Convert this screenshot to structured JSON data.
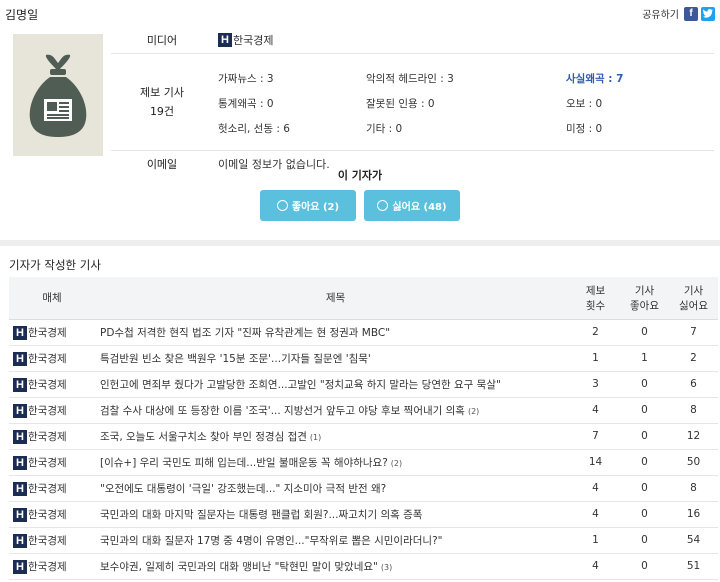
{
  "reporter": {
    "name": "김명일"
  },
  "share": {
    "label": "공유하기",
    "facebook_icon": "f",
    "twitter_icon": "t"
  },
  "profile": {
    "media_label": "미디어",
    "media_name": "한국경제",
    "media_badge": "H",
    "report_label": "제보 기사",
    "report_count": "19건",
    "counts": [
      {
        "label": "가짜뉴스 : 3",
        "highlight": false
      },
      {
        "label": "악의적 헤드라인 : 3",
        "highlight": false
      },
      {
        "label": "사실왜곡 : 7",
        "highlight": true
      },
      {
        "label": "통계왜곡 : 0",
        "highlight": false
      },
      {
        "label": "잘못된 인용 : 0",
        "highlight": false
      },
      {
        "label": "오보 : 0",
        "highlight": false
      },
      {
        "label": "헛소리, 선동 : 6",
        "highlight": false
      },
      {
        "label": "기타 : 0",
        "highlight": false
      },
      {
        "label": "미정 : 0",
        "highlight": false
      }
    ],
    "email_label": "이메일",
    "email_value": "이메일 정보가 없습니다."
  },
  "like_box": {
    "title": "이 기자가",
    "like_label": "좋아요 (2)",
    "dislike_label": "싫어요 (48)",
    "accent": "#5bc0de"
  },
  "articles_section": {
    "title": "기자가 작성한 기사",
    "headers": {
      "media": "매체",
      "title": "제목",
      "reports_1": "제보",
      "reports_2": "횟수",
      "likes_1": "기사",
      "likes_2": "좋아요",
      "dislikes_1": "기사",
      "dislikes_2": "싫어요"
    },
    "rows": [
      {
        "media": "한국경제",
        "title": "PD수첩 저격한 현직 법조 기자 \"진짜 유착관계는 현 정권과 MBC\"",
        "count": "",
        "reports": "2",
        "likes": "0",
        "dislikes": "7"
      },
      {
        "media": "한국경제",
        "title": "특검반원 빈소 찾은 백원우 '15분 조문'...기자들 질문엔 '침묵'",
        "count": "",
        "reports": "1",
        "likes": "1",
        "dislikes": "2"
      },
      {
        "media": "한국경제",
        "title": "인헌고에 면죄부 줬다가 고발당한 조희연...고발인 \"정치교육 하지 말라는 당연한 요구 묵살\"",
        "count": "",
        "reports": "3",
        "likes": "0",
        "dislikes": "6"
      },
      {
        "media": "한국경제",
        "title": "검찰 수사 대상에 또 등장한 이름 '조국'... 지방선거 앞두고 야당 후보 찍어내기 의혹",
        "count": "(2)",
        "reports": "4",
        "likes": "0",
        "dislikes": "8"
      },
      {
        "media": "한국경제",
        "title": "조국, 오늘도 서울구치소 찾아 부인 정경심 접견",
        "count": "(1)",
        "reports": "7",
        "likes": "0",
        "dislikes": "12"
      },
      {
        "media": "한국경제",
        "title": "[이슈+] 우리 국민도 피해 입는데...반일 불매운동 꼭 해야하나요?",
        "count": "(2)",
        "reports": "14",
        "likes": "0",
        "dislikes": "50"
      },
      {
        "media": "한국경제",
        "title": "\"오전에도 대통령이 '극일' 강조했는데...\" 지소미아 극적 반전 왜?",
        "count": "",
        "reports": "4",
        "likes": "0",
        "dislikes": "8"
      },
      {
        "media": "한국경제",
        "title": "국민과의 대화 마지막 질문자는 대통령 팬클럽 회원?...짜고치기 의혹 증폭",
        "count": "",
        "reports": "4",
        "likes": "0",
        "dislikes": "16"
      },
      {
        "media": "한국경제",
        "title": "국민과의 대화 질문자 17명 중 4명이 유명인...\"무작위로 뽑은 시민이라더니?\"",
        "count": "",
        "reports": "1",
        "likes": "0",
        "dislikes": "54"
      },
      {
        "media": "한국경제",
        "title": "보수야권, 일제히 국민과의 대화 맹비난 \"탁현민 말이 맞았네요\"",
        "count": "(3)",
        "reports": "4",
        "likes": "0",
        "dislikes": "51"
      }
    ]
  }
}
